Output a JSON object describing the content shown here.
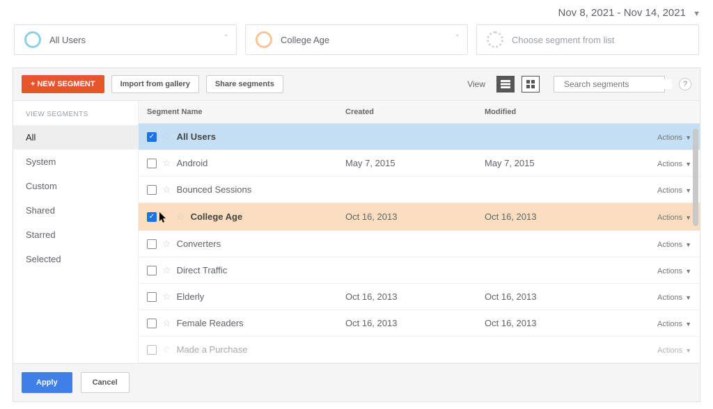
{
  "date_range": "Nov 8, 2021 - Nov 14, 2021",
  "chips": {
    "all_users": "All Users",
    "college_age": "College Age",
    "placeholder": "Choose segment from list"
  },
  "toolbar": {
    "new_segment": "+ NEW SEGMENT",
    "import": "Import from gallery",
    "share": "Share segments",
    "view_label": "View",
    "search_placeholder": "Search segments"
  },
  "sidebar": {
    "heading": "VIEW SEGMENTS",
    "items": [
      "All",
      "System",
      "Custom",
      "Shared",
      "Starred",
      "Selected"
    ]
  },
  "columns": {
    "name": "Segment Name",
    "created": "Created",
    "modified": "Modified"
  },
  "actions_label": "Actions",
  "rows": [
    {
      "name": "All Users",
      "created": "",
      "modified": "",
      "checked": true,
      "highlight": "blue"
    },
    {
      "name": "Android",
      "created": "May 7, 2015",
      "modified": "May 7, 2015",
      "checked": false,
      "highlight": ""
    },
    {
      "name": "Bounced Sessions",
      "created": "",
      "modified": "",
      "checked": false,
      "highlight": ""
    },
    {
      "name": "College Age",
      "created": "Oct 16, 2013",
      "modified": "Oct 16, 2013",
      "checked": true,
      "highlight": "orange"
    },
    {
      "name": "Converters",
      "created": "",
      "modified": "",
      "checked": false,
      "highlight": ""
    },
    {
      "name": "Direct Traffic",
      "created": "",
      "modified": "",
      "checked": false,
      "highlight": ""
    },
    {
      "name": "Elderly",
      "created": "Oct 16, 2013",
      "modified": "Oct 16, 2013",
      "checked": false,
      "highlight": ""
    },
    {
      "name": "Female Readers",
      "created": "Oct 16, 2013",
      "modified": "Oct 16, 2013",
      "checked": false,
      "highlight": ""
    },
    {
      "name": "Made a Purchase",
      "created": "",
      "modified": "",
      "checked": false,
      "highlight": ""
    }
  ],
  "footer": {
    "apply": "Apply",
    "cancel": "Cancel"
  }
}
